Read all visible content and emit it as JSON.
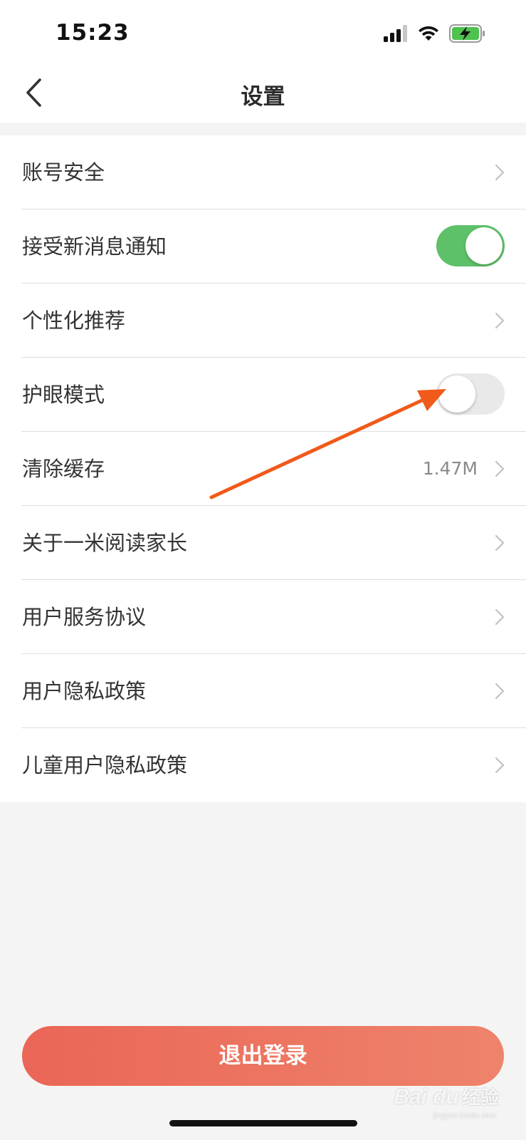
{
  "status_bar": {
    "time": "15:23",
    "icons": [
      "cellular-signal-icon",
      "wifi-icon",
      "battery-charging-icon"
    ]
  },
  "nav": {
    "title": "设置",
    "back_icon": "chevron-left-icon"
  },
  "settings": {
    "items": [
      {
        "label": "账号安全",
        "type": "link"
      },
      {
        "label": "接受新消息通知",
        "type": "toggle",
        "on": true
      },
      {
        "label": "个性化推荐",
        "type": "link"
      },
      {
        "label": "护眼模式",
        "type": "toggle",
        "on": false
      },
      {
        "label": "清除缓存",
        "type": "link",
        "value": "1.47M"
      },
      {
        "label": "关于一米阅读家长",
        "type": "link"
      },
      {
        "label": "用户服务协议",
        "type": "link"
      },
      {
        "label": "用户隐私政策",
        "type": "link"
      },
      {
        "label": "儿童用户隐私政策",
        "type": "link"
      }
    ]
  },
  "logout": {
    "label": "退出登录"
  },
  "watermark": {
    "logo": "Bai du",
    "cn": "经验",
    "url": "jingyan.baidu.com"
  },
  "colors": {
    "toggle_on": "#5ec169",
    "toggle_off": "#e9e9e9",
    "logout_start": "#ea6656",
    "logout_end": "#ee836c",
    "annotation_arrow": "#f05a1a"
  }
}
